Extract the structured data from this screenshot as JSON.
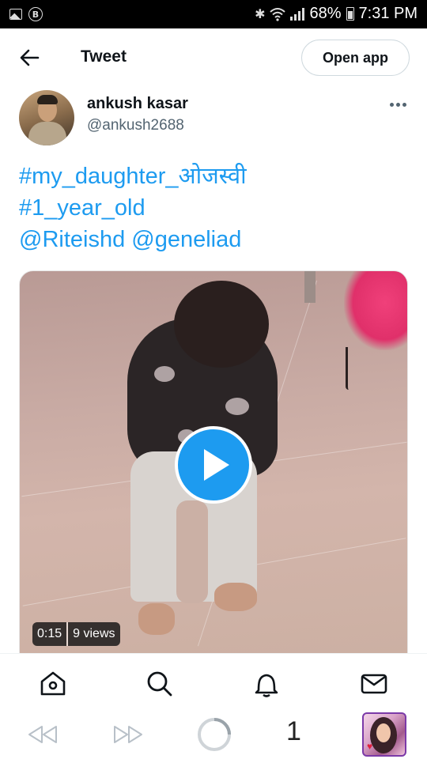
{
  "status_bar": {
    "battery": "68%",
    "time": "7:31 PM",
    "icons": [
      "image-icon",
      "b-badge-icon",
      "bluetooth-icon",
      "wifi-icon",
      "signal-icon",
      "battery-icon"
    ]
  },
  "header": {
    "title": "Tweet",
    "open_app_label": "Open app",
    "back_icon": "arrow-left-icon"
  },
  "author": {
    "name": "ankush kasar",
    "handle": "@ankush2688",
    "more_icon": "more-horizontal-icon"
  },
  "tweet": {
    "lines": [
      "#my_daughter_ओजस्वी",
      "#1_year_old",
      "@Riteishd @geneliad"
    ],
    "link_color": "#1d9bf0"
  },
  "video": {
    "duration": "0:15",
    "views": "9 views",
    "play_icon": "play-icon",
    "play_color": "#1d9bf0"
  },
  "bottom_nav": {
    "items": [
      "home-icon",
      "search-icon",
      "notifications-icon",
      "messages-icon"
    ]
  },
  "browser_bar": {
    "tab_count": "1",
    "icons": [
      "rewind-icon",
      "fast-forward-icon",
      "loading-icon"
    ]
  }
}
